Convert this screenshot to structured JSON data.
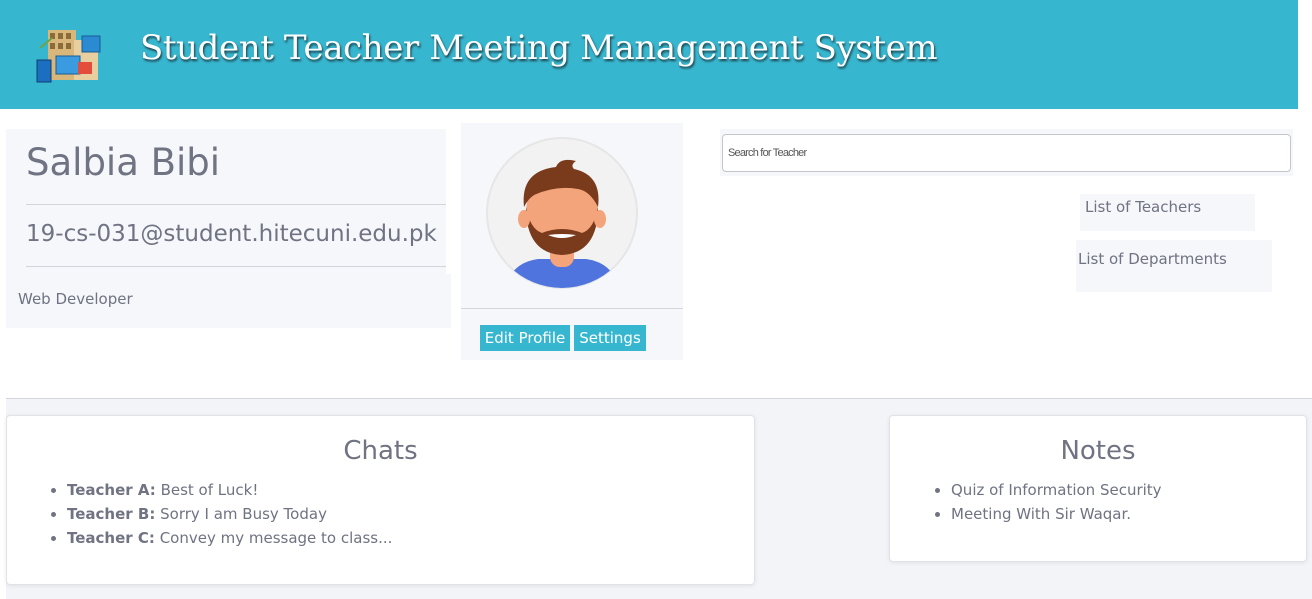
{
  "header": {
    "title": "Student Teacher Meeting Management System",
    "logo_icon": "classroom-meeting-logo-icon"
  },
  "profile": {
    "name": "Salbia Bibi",
    "email": "19-cs-031@student.hitecuni.edu.pk",
    "role": "Web Developer",
    "avatar_icon": "bearded-man-avatar-icon"
  },
  "actions": {
    "edit_profile": "Edit Profile",
    "settings": "Settings"
  },
  "search": {
    "placeholder": "Search for Teacher"
  },
  "links": {
    "teachers": "List of Teachers",
    "departments": "List of Departments"
  },
  "chats": {
    "title": "Chats",
    "items": [
      {
        "sender": "Teacher A:",
        "message": "Best of Luck!"
      },
      {
        "sender": "Teacher B:",
        "message": "Sorry I am Busy Today"
      },
      {
        "sender": "Teacher C:",
        "message": "Convey my message to class..."
      }
    ]
  },
  "notes": {
    "title": "Notes",
    "items": [
      "Quiz of Information Security",
      "Meeting With Sir Waqar."
    ]
  },
  "colors": {
    "accent": "#37b7cf",
    "card_bg": "#f6f7fb",
    "text": "#6f7382"
  }
}
